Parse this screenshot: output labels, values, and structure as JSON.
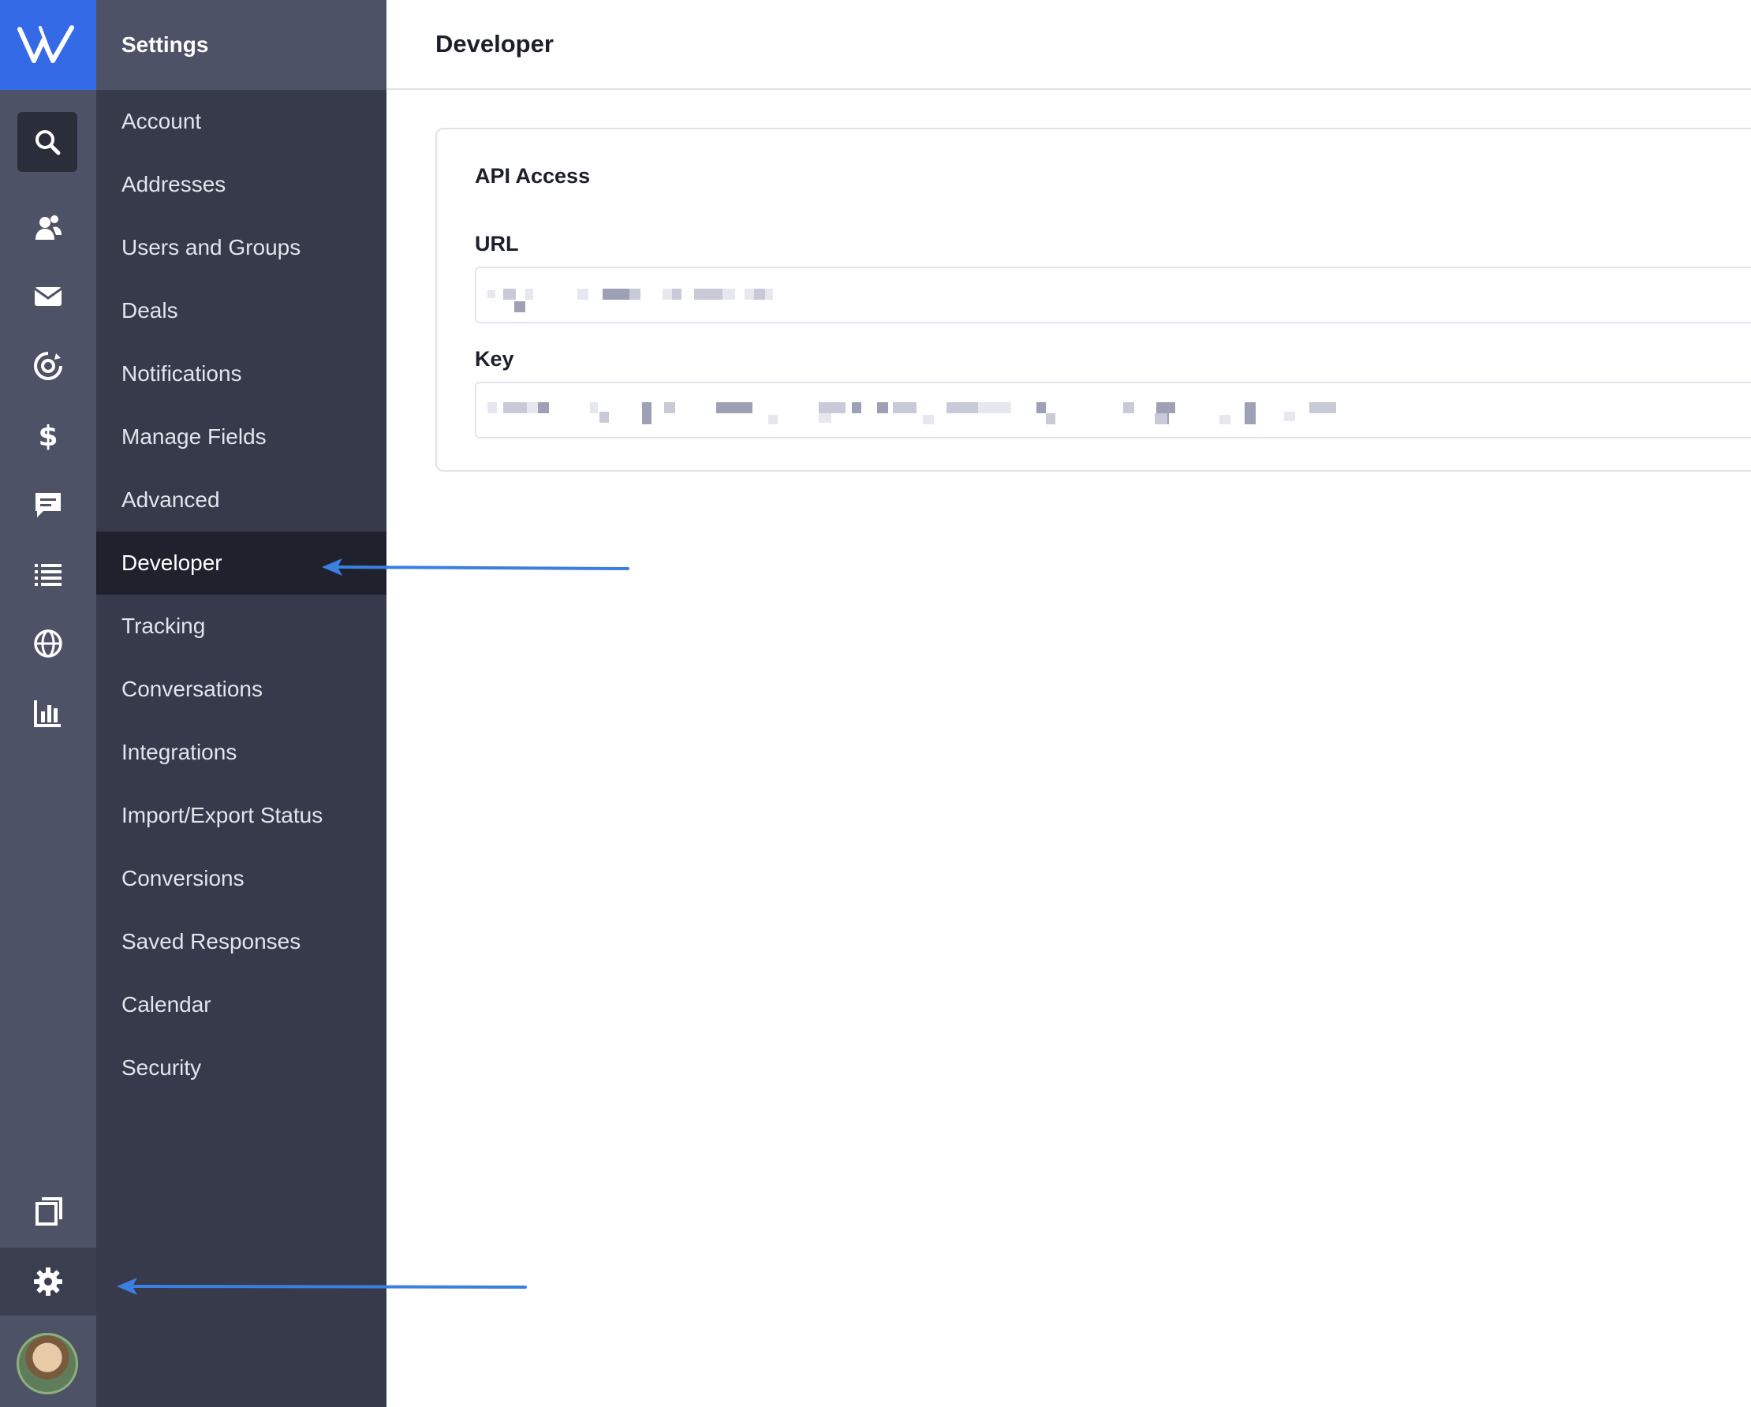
{
  "rail": {
    "logo": "WA",
    "icons": [
      "search-icon",
      "contacts-icon",
      "mail-icon",
      "automation-icon",
      "dollar-icon",
      "chat-icon",
      "list-icon",
      "globe-icon",
      "chart-icon",
      "pages-icon",
      "gear-icon",
      "avatar"
    ]
  },
  "nav": {
    "title": "Settings",
    "items": [
      {
        "label": "Account"
      },
      {
        "label": "Addresses"
      },
      {
        "label": "Users and Groups"
      },
      {
        "label": "Deals"
      },
      {
        "label": "Notifications"
      },
      {
        "label": "Manage Fields"
      },
      {
        "label": "Advanced"
      },
      {
        "label": "Developer",
        "active": true
      },
      {
        "label": "Tracking"
      },
      {
        "label": "Conversations"
      },
      {
        "label": "Integrations"
      },
      {
        "label": "Import/Export Status"
      },
      {
        "label": "Conversions"
      },
      {
        "label": "Saved Responses"
      },
      {
        "label": "Calendar"
      },
      {
        "label": "Security"
      }
    ]
  },
  "main": {
    "title": "Developer",
    "card": {
      "title": "API Access",
      "url_label": "URL",
      "key_label": "Key"
    }
  },
  "colors": {
    "accent": "#356ae6",
    "rail": "#4d5266",
    "nav": "#363a4a",
    "nav_active": "#1f222c",
    "annotation_arrow": "#3b7fe0"
  }
}
